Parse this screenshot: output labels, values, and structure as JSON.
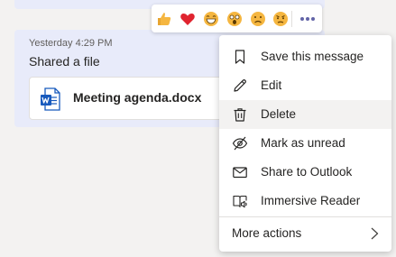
{
  "message": {
    "timestamp": "Yesterday 4:29 PM",
    "text": "Shared a file",
    "file": {
      "name": "Meeting agenda.docx",
      "type_icon": "word-doc-icon"
    }
  },
  "reactions": [
    {
      "name": "like",
      "icon": "thumbs-up-icon",
      "color": "#f5b640"
    },
    {
      "name": "heart",
      "icon": "heart-icon",
      "color": "#e0242f"
    },
    {
      "name": "laugh",
      "icon": "laugh-icon",
      "color": "#f5b640"
    },
    {
      "name": "surprised",
      "icon": "surprised-icon",
      "color": "#f5b640"
    },
    {
      "name": "sad",
      "icon": "sad-icon",
      "color": "#f5b640"
    },
    {
      "name": "angry",
      "icon": "angry-icon",
      "color": "#f5b640"
    }
  ],
  "menu": {
    "items": [
      {
        "label": "Save this message",
        "icon": "bookmark-icon"
      },
      {
        "label": "Edit",
        "icon": "pencil-icon"
      },
      {
        "label": "Delete",
        "icon": "trash-icon",
        "hovered": true
      },
      {
        "label": "Mark as unread",
        "icon": "mark-unread-icon"
      },
      {
        "label": "Share to Outlook",
        "icon": "envelope-icon"
      },
      {
        "label": "Immersive Reader",
        "icon": "immersive-reader-icon"
      }
    ],
    "more_actions": "More actions"
  },
  "colors": {
    "accent": "#6264a7",
    "bubble": "#e8ebfa",
    "background": "#f3f2f1",
    "word_blue": "#185abd"
  }
}
